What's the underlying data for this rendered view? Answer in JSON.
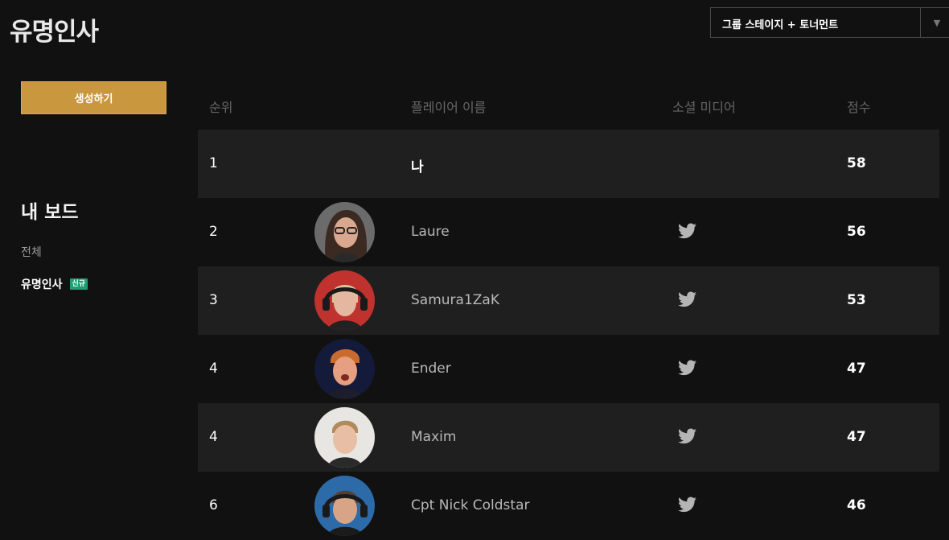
{
  "header": {
    "title": "유명인사",
    "stage_select": {
      "value": "그룹 스테이지 + 토너먼트",
      "arrow_icon": "caret-down-icon"
    }
  },
  "sidebar": {
    "create_label": "생성하기",
    "board_heading": "내 보드",
    "nav_all": "전체",
    "nav_famous": "유명인사",
    "new_badge": "신규"
  },
  "table": {
    "columns": {
      "rank": "순위",
      "player": "플레이어 이름",
      "social": "소셜 미디어",
      "score": "점수"
    },
    "rows": [
      {
        "rank": "1",
        "name": "나",
        "score": "58",
        "avatar": null,
        "social": null
      },
      {
        "rank": "2",
        "name": "Laure",
        "score": "56",
        "avatar": "laure-avatar",
        "social": "twitter-icon"
      },
      {
        "rank": "3",
        "name": "Samura1ZaK",
        "score": "53",
        "avatar": "samura1zak-avatar",
        "social": "twitter-icon"
      },
      {
        "rank": "4",
        "name": "Ender",
        "score": "47",
        "avatar": "ender-avatar",
        "social": "twitter-icon"
      },
      {
        "rank": "4",
        "name": "Maxim",
        "score": "47",
        "avatar": "maxim-avatar",
        "social": "twitter-icon"
      },
      {
        "rank": "6",
        "name": "Cpt Nick Coldstar",
        "score": "46",
        "avatar": "cpt-nick-coldstar-avatar",
        "social": "twitter-icon"
      }
    ]
  },
  "colors": {
    "background": "#111111",
    "row_shade": "#1f1f1f",
    "accent_gold": "#c9973e",
    "badge_green": "#1e9f73"
  }
}
